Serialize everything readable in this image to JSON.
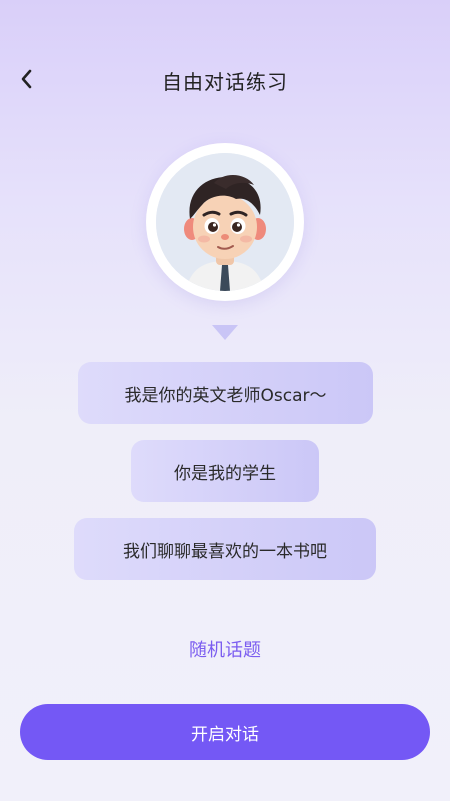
{
  "header": {
    "title": "自由对话练习",
    "back_icon": "chevron-left-icon"
  },
  "avatar": {
    "name": "teacher-avatar"
  },
  "messages": [
    {
      "text": "我是你的英文老师Oscar～"
    },
    {
      "text": "你是我的学生"
    },
    {
      "text": "我们聊聊最喜欢的一本书吧"
    }
  ],
  "random_topic_label": "随机话题",
  "start_button_label": "开启对话",
  "colors": {
    "accent": "#7458f5",
    "link": "#7b5df0",
    "bubble_start": "#dedbfb",
    "bubble_end": "#cbc7f7"
  }
}
